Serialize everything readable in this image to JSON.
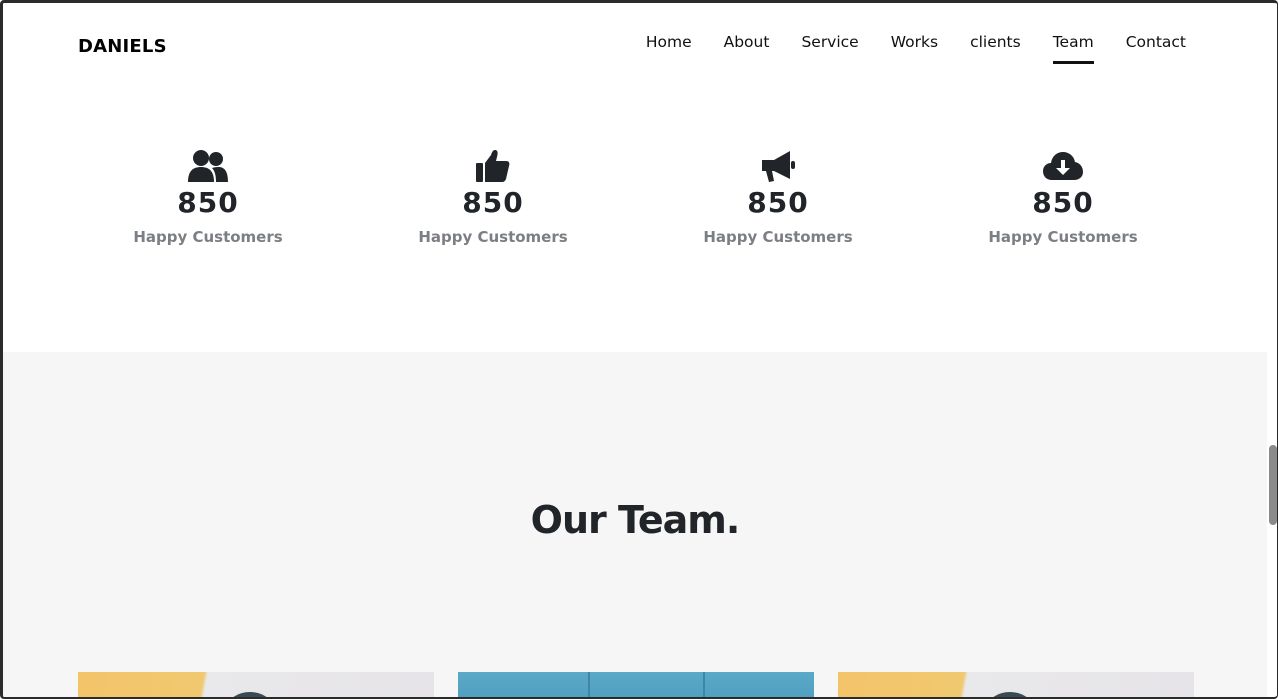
{
  "brand": "DANIELS",
  "nav": [
    {
      "label": "Home",
      "active": false
    },
    {
      "label": "About",
      "active": false
    },
    {
      "label": "Service",
      "active": false
    },
    {
      "label": "Works",
      "active": false
    },
    {
      "label": "clients",
      "active": false
    },
    {
      "label": "Team",
      "active": true
    },
    {
      "label": "Contact",
      "active": false
    }
  ],
  "stats": [
    {
      "icon": "users-icon",
      "number": "850",
      "label": "Happy Customers"
    },
    {
      "icon": "thumbs-up-icon",
      "number": "850",
      "label": "Happy Customers"
    },
    {
      "icon": "megaphone-icon",
      "number": "850",
      "label": "Happy Customers"
    },
    {
      "icon": "cloud-download-icon",
      "number": "850",
      "label": "Happy Customers"
    }
  ],
  "team": {
    "title": "Our Team."
  },
  "colors": {
    "text_dark": "#212529",
    "label_gray": "#7b7f84",
    "section_bg": "#f6f6f6"
  }
}
